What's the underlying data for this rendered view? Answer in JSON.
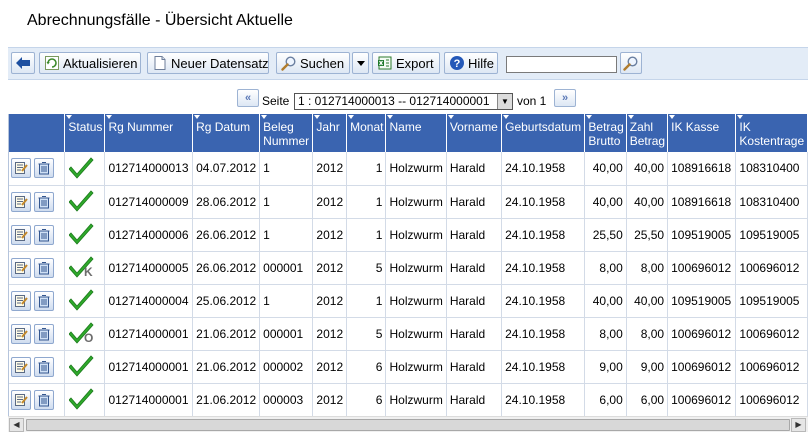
{
  "page": {
    "title": "Abrechnungsfälle - Übersicht Aktuelle"
  },
  "toolbar": {
    "refresh_label": "Aktualisieren",
    "new_label": "Neuer Datensatz",
    "search_label": "Suchen",
    "export_label": "Export",
    "help_label": "Hilfe",
    "search_value": ""
  },
  "pager": {
    "page_label": "Seite",
    "page_selected": "1 : 012714000013 -- 012714000001",
    "of_label": "von 1"
  },
  "columns": [
    "",
    "Status",
    "Rg Nummer",
    "Rg Datum",
    "Beleg Nummer",
    "Jahr",
    "Monat",
    "Name",
    "Vorname",
    "Geburtsdatum",
    "Betrag Brutto",
    "Zahl Betrag",
    "IK Kasse",
    "IK Kostentrage"
  ],
  "rows": [
    {
      "status": "ok",
      "rg_nummer": "012714000013",
      "rg_datum": "04.07.2012",
      "beleg": "1",
      "jahr": "2012",
      "monat": "1",
      "name": "Holzwurm",
      "vorname": "Harald",
      "geburtsdatum": "24.10.1958",
      "betrag": "40,00",
      "zahl": "40,00",
      "ik_kasse": "108916618",
      "ik_kosten": "108310400"
    },
    {
      "status": "ok",
      "rg_nummer": "012714000009",
      "rg_datum": "28.06.2012",
      "beleg": "1",
      "jahr": "2012",
      "monat": "1",
      "name": "Holzwurm",
      "vorname": "Harald",
      "geburtsdatum": "24.10.1958",
      "betrag": "40,00",
      "zahl": "40,00",
      "ik_kasse": "108916618",
      "ik_kosten": "108310400"
    },
    {
      "status": "ok",
      "rg_nummer": "012714000006",
      "rg_datum": "26.06.2012",
      "beleg": "1",
      "jahr": "2012",
      "monat": "1",
      "name": "Holzwurm",
      "vorname": "Harald",
      "geburtsdatum": "24.10.1958",
      "betrag": "25,50",
      "zahl": "25,50",
      "ik_kasse": "109519005",
      "ik_kosten": "109519005"
    },
    {
      "status": "ok-k",
      "rg_nummer": "012714000005",
      "rg_datum": "26.06.2012",
      "beleg": "000001",
      "jahr": "2012",
      "monat": "5",
      "name": "Holzwurm",
      "vorname": "Harald",
      "geburtsdatum": "24.10.1958",
      "betrag": "8,00",
      "zahl": "8,00",
      "ik_kasse": "100696012",
      "ik_kosten": "100696012"
    },
    {
      "status": "ok",
      "rg_nummer": "012714000004",
      "rg_datum": "25.06.2012",
      "beleg": "1",
      "jahr": "2012",
      "monat": "1",
      "name": "Holzwurm",
      "vorname": "Harald",
      "geburtsdatum": "24.10.1958",
      "betrag": "40,00",
      "zahl": "40,00",
      "ik_kasse": "109519005",
      "ik_kosten": "109519005"
    },
    {
      "status": "ok-o",
      "rg_nummer": "012714000001",
      "rg_datum": "21.06.2012",
      "beleg": "000001",
      "jahr": "2012",
      "monat": "5",
      "name": "Holzwurm",
      "vorname": "Harald",
      "geburtsdatum": "24.10.1958",
      "betrag": "8,00",
      "zahl": "8,00",
      "ik_kasse": "100696012",
      "ik_kosten": "100696012"
    },
    {
      "status": "ok",
      "rg_nummer": "012714000001",
      "rg_datum": "21.06.2012",
      "beleg": "000002",
      "jahr": "2012",
      "monat": "6",
      "name": "Holzwurm",
      "vorname": "Harald",
      "geburtsdatum": "24.10.1958",
      "betrag": "9,00",
      "zahl": "9,00",
      "ik_kasse": "100696012",
      "ik_kosten": "100696012"
    },
    {
      "status": "ok",
      "rg_nummer": "012714000001",
      "rg_datum": "21.06.2012",
      "beleg": "000003",
      "jahr": "2012",
      "monat": "6",
      "name": "Holzwurm",
      "vorname": "Harald",
      "geburtsdatum": "24.10.1958",
      "betrag": "6,00",
      "zahl": "6,00",
      "ik_kasse": "100696012",
      "ik_kosten": "100696012"
    }
  ],
  "colors": {
    "header_bg": "#3a64b0",
    "check_green": "#2fa92b",
    "toolbar_bg": "#e3ecf7"
  },
  "icons": {
    "back": "arrow-left-icon",
    "refresh": "refresh-icon",
    "new": "document-icon",
    "search": "magnifier-icon",
    "export": "excel-export-icon",
    "help": "help-icon",
    "edit": "edit-icon",
    "delete": "trash-icon",
    "status": "checkmark-icon"
  }
}
